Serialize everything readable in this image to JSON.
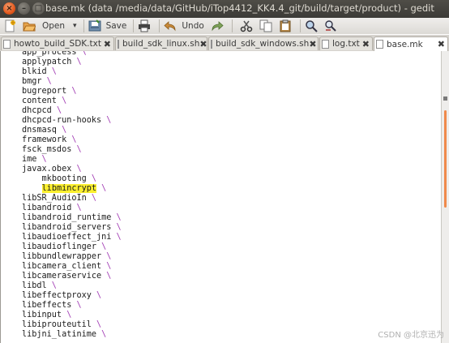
{
  "window": {
    "title": "base.mk (data /media/data/GitHub/iTop4412_KK4.4_git/build/target/product) - gedit"
  },
  "toolbar": {
    "open_label": "Open",
    "save_label": "Save",
    "undo_label": "Undo",
    "open_dropdown": "▾"
  },
  "tabs": [
    {
      "label": "howto_build_SDK.txt"
    },
    {
      "label": "build_sdk_linux.sh"
    },
    {
      "label": "build_sdk_windows.sh"
    },
    {
      "label": "log.txt"
    },
    {
      "label": "base.mk"
    }
  ],
  "tab_close_glyph": "✖",
  "editor": {
    "lines": [
      "app_process \\",
      "applypatch \\",
      "blkid \\",
      "bmgr \\",
      "bugreport \\",
      "content \\",
      "dhcpcd \\",
      "dhcpcd-run-hooks \\",
      "dnsmasq \\",
      "framework \\",
      "fsck_msdos \\",
      "ime \\",
      "javax.obex \\",
      "    mkbooting \\",
      "    libmincrypt \\",
      "libSR_AudioIn \\",
      "libandroid \\",
      "libandroid_runtime \\",
      "libandroid_servers \\",
      "libaudioeffect_jni \\",
      "libaudioflinger \\",
      "libbundlewrapper \\",
      "libcamera_client \\",
      "libcameraservice \\",
      "libdl \\",
      "libeffectproxy \\",
      "libeffects \\",
      "libinput \\",
      "libiprouteutil \\",
      "libjni_latinime \\"
    ],
    "highlighted_text": "libmincrypt",
    "highlight_color": "#fbef2f",
    "backslash_color": "#a33fb5"
  },
  "watermark": "CSDN @北京迅为"
}
